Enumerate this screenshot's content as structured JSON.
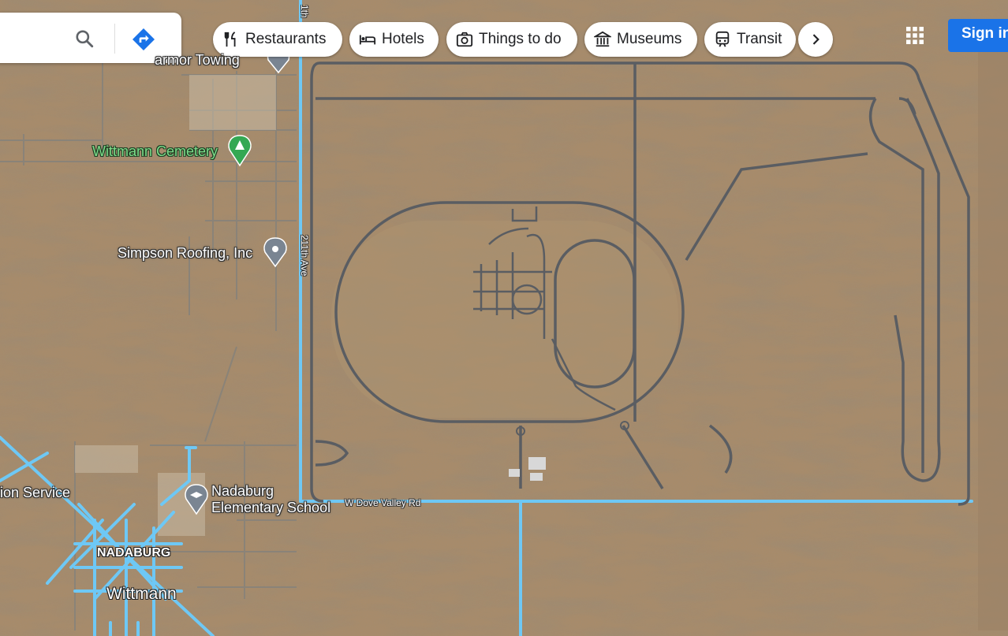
{
  "search": {
    "search_icon": "search-icon",
    "directions_icon": "directions-icon"
  },
  "chips": [
    {
      "label": "Restaurants",
      "icon": "fork-knife-icon"
    },
    {
      "label": "Hotels",
      "icon": "bed-icon"
    },
    {
      "label": "Things to do",
      "icon": "camera-icon"
    },
    {
      "label": "Museums",
      "icon": "museum-icon"
    },
    {
      "label": "Transit",
      "icon": "train-icon"
    }
  ],
  "more_icon": "chevron-right-icon",
  "apps_icon": "apps-grid-icon",
  "sign_in": "Sign in",
  "places": {
    "towing": "armor Towing",
    "cemetery": "Wittmann Cemetery",
    "roofing": "Simpson Roofing, Inc",
    "school_line1": "Nadaburg",
    "school_line2": "Elementary School",
    "service": "ion Service",
    "nadaburg": "NADABURG",
    "wittmann": "Wittmann"
  },
  "roads": {
    "ave_top": "1th",
    "ave": "211th Ave",
    "dove_valley": "W Dove Valley Rd"
  },
  "colors": {
    "accent": "#1a73e8",
    "highlight_road": "#6ec8f5",
    "terrain": "#a88a68",
    "track": "#5a5d62"
  }
}
